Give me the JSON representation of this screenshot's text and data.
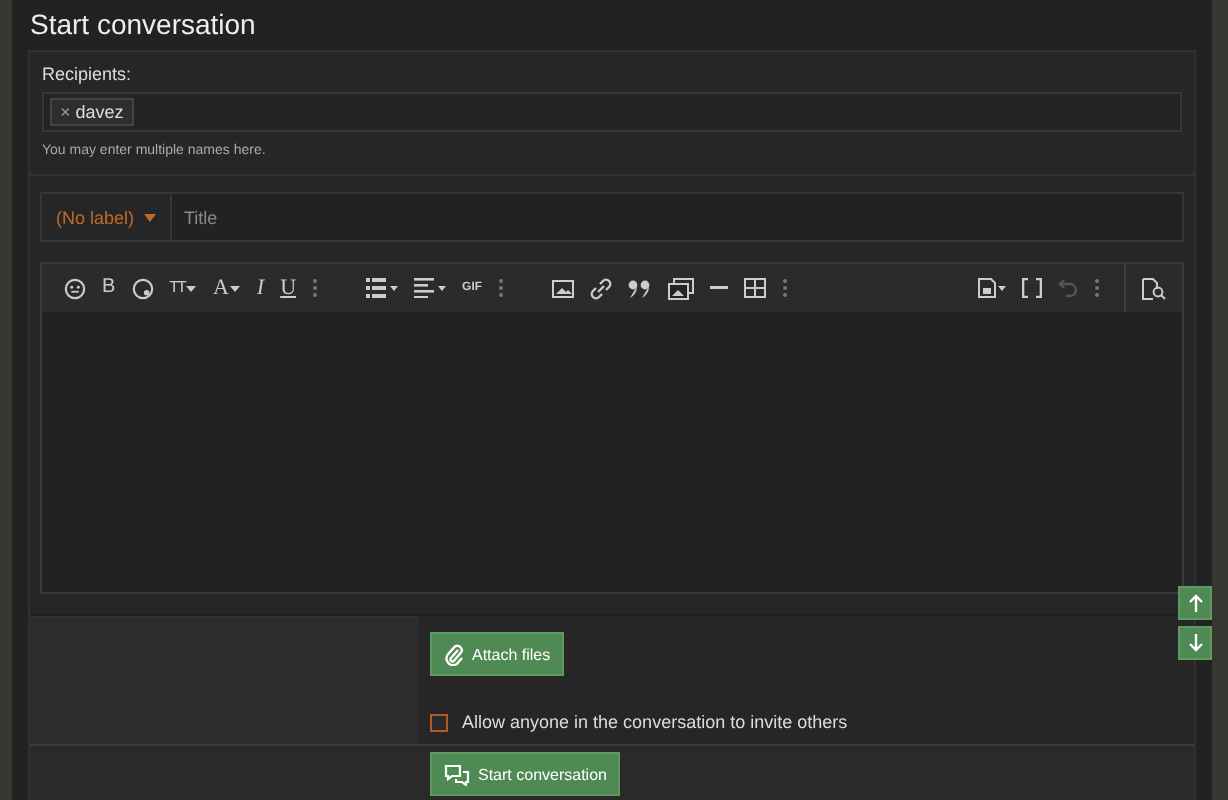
{
  "title": "Start conversation",
  "recipients": {
    "label": "Recipients:",
    "tokens": [
      {
        "remove": "×",
        "name": "davez"
      }
    ],
    "hint": "You may enter multiple names here."
  },
  "title_row": {
    "prefix": "(No label)",
    "placeholder": "Title"
  },
  "editor": {
    "toolbar_text": [
      "B",
      "TT",
      "A",
      "I",
      "U",
      "GIF"
    ],
    "undo": {
      "disabled": true
    }
  },
  "attach_button": "Attach files",
  "options": [
    {
      "label": "Allow anyone in the conversation to invite others",
      "checked": false
    }
  ],
  "submit_button": "Start conversation"
}
